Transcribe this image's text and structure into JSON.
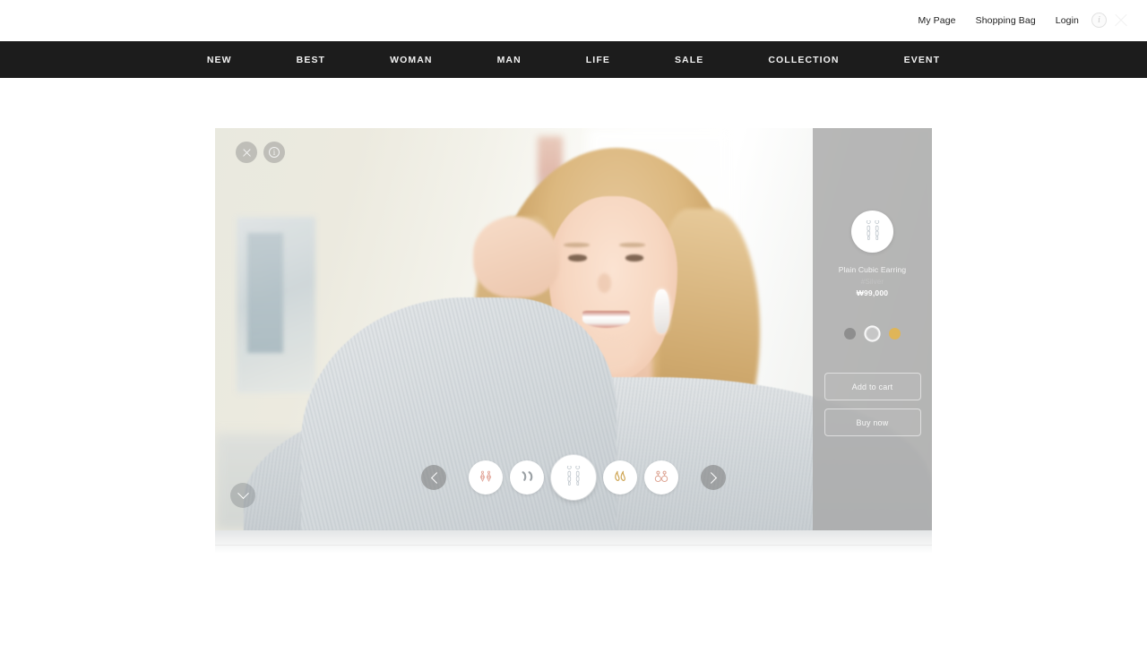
{
  "utility": {
    "links": [
      {
        "label": "My Page"
      },
      {
        "label": "Shopping Bag"
      },
      {
        "label": "Login"
      }
    ],
    "info_glyph": "i",
    "info_icon": "info-circle-icon",
    "close_icon": "close-icon"
  },
  "nav": {
    "items": [
      {
        "label": "NEW"
      },
      {
        "label": "BEST"
      },
      {
        "label": "WOMAN"
      },
      {
        "label": "MAN"
      },
      {
        "label": "LIFE"
      },
      {
        "label": "SALE"
      },
      {
        "label": "COLLECTION"
      },
      {
        "label": "EVENT"
      }
    ]
  },
  "hero": {
    "close_icon": "close-icon",
    "info_icon": "info-circle-icon",
    "info_glyph": "i",
    "scroll_down_icon": "chevron-down-icon",
    "carousel": {
      "prev_icon": "chevron-left-icon",
      "next_icon": "chevron-right-icon",
      "active_index": 2,
      "thumbnails": [
        {
          "name": "rose-drop-earring-thumbnail",
          "color": "#e8b0a6"
        },
        {
          "name": "silver-hoop-earring-thumbnail",
          "color": "#9aa0a4"
        },
        {
          "name": "plain-cubic-earring-thumbnail",
          "color": "#c8ced2"
        },
        {
          "name": "gold-teardrop-earring-thumbnail",
          "color": "#d0a858"
        },
        {
          "name": "rose-circle-earring-thumbnail",
          "color": "#dca99a"
        }
      ]
    }
  },
  "product": {
    "thumbnail_icon": "plain-cubic-earring-icon",
    "name": "Plain Cubic Earring",
    "tag": "#Silver",
    "price": "₩99,000",
    "swatches": [
      {
        "name": "swatch-dark-gray",
        "color": "#8e8e8e",
        "selected": false
      },
      {
        "name": "swatch-silver",
        "color": "#c6c6c6",
        "selected": true
      },
      {
        "name": "swatch-gold",
        "color": "#dfb558",
        "selected": false
      }
    ],
    "add_to_cart_label": "Add to cart",
    "buy_now_label": "Buy now"
  },
  "colors": {
    "nav_background": "#1c1c1c",
    "page_background": "#ffffff",
    "panel_background": "#a8a8a8",
    "text_light": "#f3f3f3"
  }
}
